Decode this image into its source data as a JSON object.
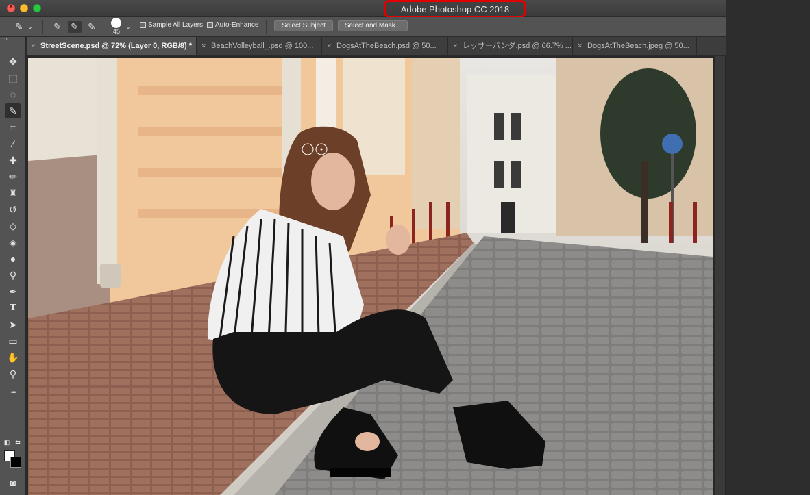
{
  "window": {
    "app_title": "Adobe Photoshop CC 2018"
  },
  "options_bar": {
    "brush_size": "45",
    "sample_all_layers_label": "Sample All Layers",
    "auto_enhance_label": "Auto-Enhance",
    "select_subject_label": "Select Subject",
    "select_and_mask_label": "Select and Mask..."
  },
  "tabs": [
    {
      "label": "StreetScene.psd @ 72% (Layer 0, RGB/8) *",
      "active": true
    },
    {
      "label": "BeachVolleyball_.psd @ 100...",
      "active": false
    },
    {
      "label": "DogsAtTheBeach.psd @ 50...",
      "active": false
    },
    {
      "label": "レッサーパンダ.psd @ 66.7% ...",
      "active": false
    },
    {
      "label": "DogsAtTheBeach.jpeg @ 50...",
      "active": false
    }
  ],
  "tab_close_glyph": "×",
  "toolbar": {
    "collapse_glyph": "››",
    "tools": [
      {
        "name": "move-tool",
        "glyph": "✥"
      },
      {
        "name": "marquee-tool",
        "glyph": "⬚"
      },
      {
        "name": "lasso-tool",
        "glyph": "◌"
      },
      {
        "name": "quick-selection-tool",
        "glyph": "✎"
      },
      {
        "name": "crop-tool",
        "glyph": "⌗"
      },
      {
        "name": "eyedropper-tool",
        "glyph": "⁄"
      },
      {
        "name": "healing-brush-tool",
        "glyph": "✚"
      },
      {
        "name": "brush-tool",
        "glyph": "✏"
      },
      {
        "name": "clone-stamp-tool",
        "glyph": "♜"
      },
      {
        "name": "history-brush-tool",
        "glyph": "↺"
      },
      {
        "name": "eraser-tool",
        "glyph": "◇"
      },
      {
        "name": "paint-bucket-tool",
        "glyph": "◈"
      },
      {
        "name": "blur-tool",
        "glyph": "●"
      },
      {
        "name": "dodge-tool",
        "glyph": "⚲"
      },
      {
        "name": "pen-tool",
        "glyph": "✒"
      },
      {
        "name": "type-tool",
        "glyph": "T"
      },
      {
        "name": "path-selection-tool",
        "glyph": "➤"
      },
      {
        "name": "rectangle-tool",
        "glyph": "▭"
      },
      {
        "name": "hand-tool",
        "glyph": "✋"
      },
      {
        "name": "zoom-tool",
        "glyph": "⚲"
      },
      {
        "name": "more-tools",
        "glyph": "•••"
      }
    ],
    "foreground_color": "#ffffff",
    "background_color": "#000000"
  },
  "colors": {
    "title_highlight": "#e00000",
    "panel": "#535353",
    "tab_inactive": "#3d3d3d"
  }
}
